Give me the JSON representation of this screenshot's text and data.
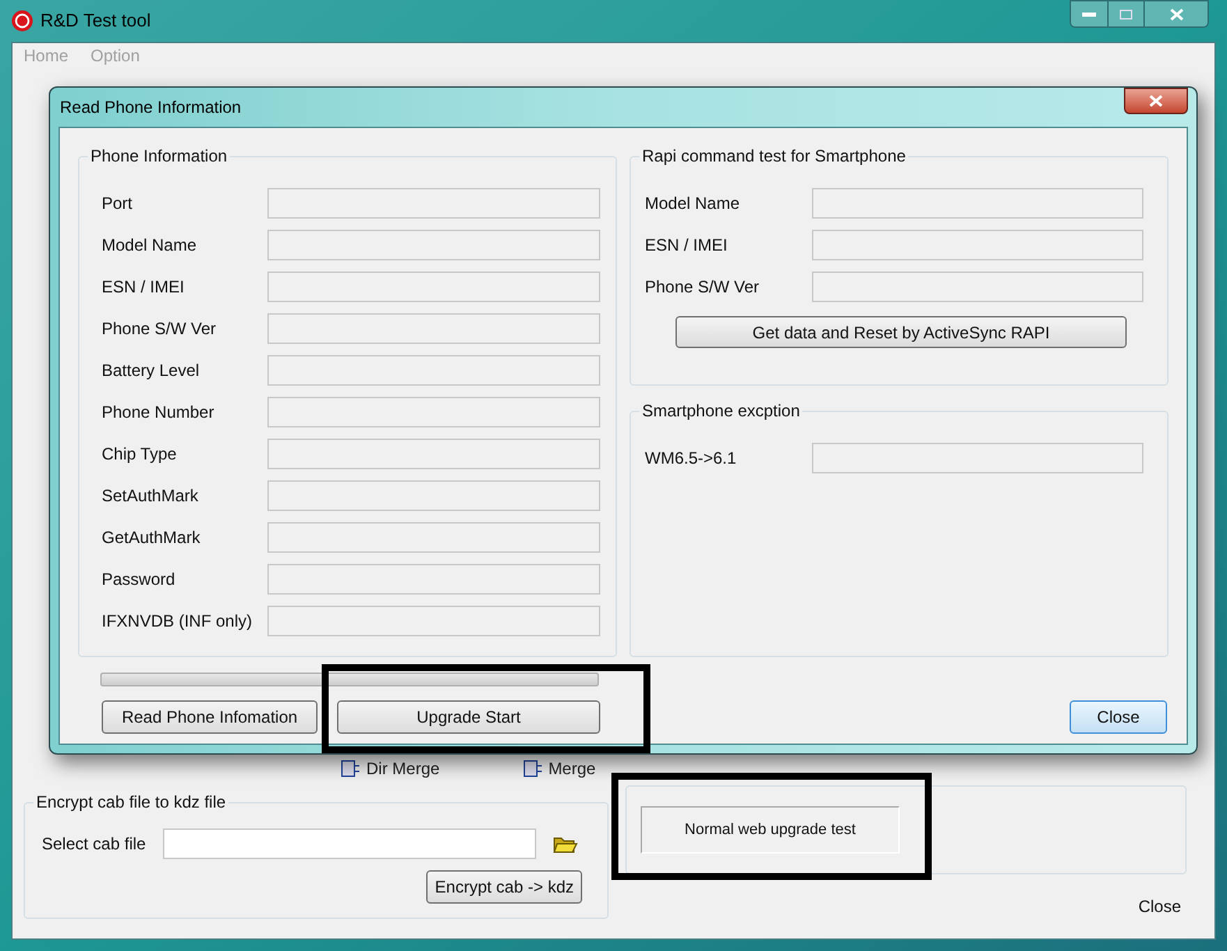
{
  "window": {
    "title": "R&D Test tool"
  },
  "menu": [
    {
      "label": "Home"
    },
    {
      "label": "Option"
    }
  ],
  "dialog": {
    "title": "Read Phone Information",
    "phone_information": {
      "title": "Phone Information",
      "fields": [
        {
          "label": "Port"
        },
        {
          "label": "Model Name"
        },
        {
          "label": "ESN / IMEI"
        },
        {
          "label": "Phone S/W Ver"
        },
        {
          "label": "Battery Level"
        },
        {
          "label": "Phone Number"
        },
        {
          "label": "Chip Type"
        },
        {
          "label": "SetAuthMark"
        },
        {
          "label": "GetAuthMark"
        },
        {
          "label": "Password"
        },
        {
          "label": "IFXNVDB (INF only)"
        }
      ]
    },
    "rapi": {
      "title": "Rapi command test for Smartphone",
      "fields": [
        {
          "label": "Model Name"
        },
        {
          "label": "ESN / IMEI"
        },
        {
          "label": "Phone S/W Ver"
        }
      ],
      "button": "Get data and Reset by ActiveSync RAPI"
    },
    "exception": {
      "title": "Smartphone excption",
      "fields": [
        {
          "label": "WM6.5->6.1"
        }
      ]
    },
    "progress": {
      "level": 0
    },
    "buttons": [
      {
        "label": "Read Phone Infomation",
        "kind": "normal"
      },
      {
        "label": "Upgrade Start",
        "kind": "normal"
      },
      {
        "label": "Close",
        "kind": "default"
      }
    ]
  },
  "main": {
    "merge_buttons": [
      "Dir Merge",
      "Merge"
    ],
    "encrypt": {
      "title": "Encrypt cab file to kdz file",
      "label": "Select cab file",
      "button": "Encrypt cab -> kdz"
    },
    "web_upgrade_button": "Normal web upgrade test",
    "close": "Close"
  }
}
